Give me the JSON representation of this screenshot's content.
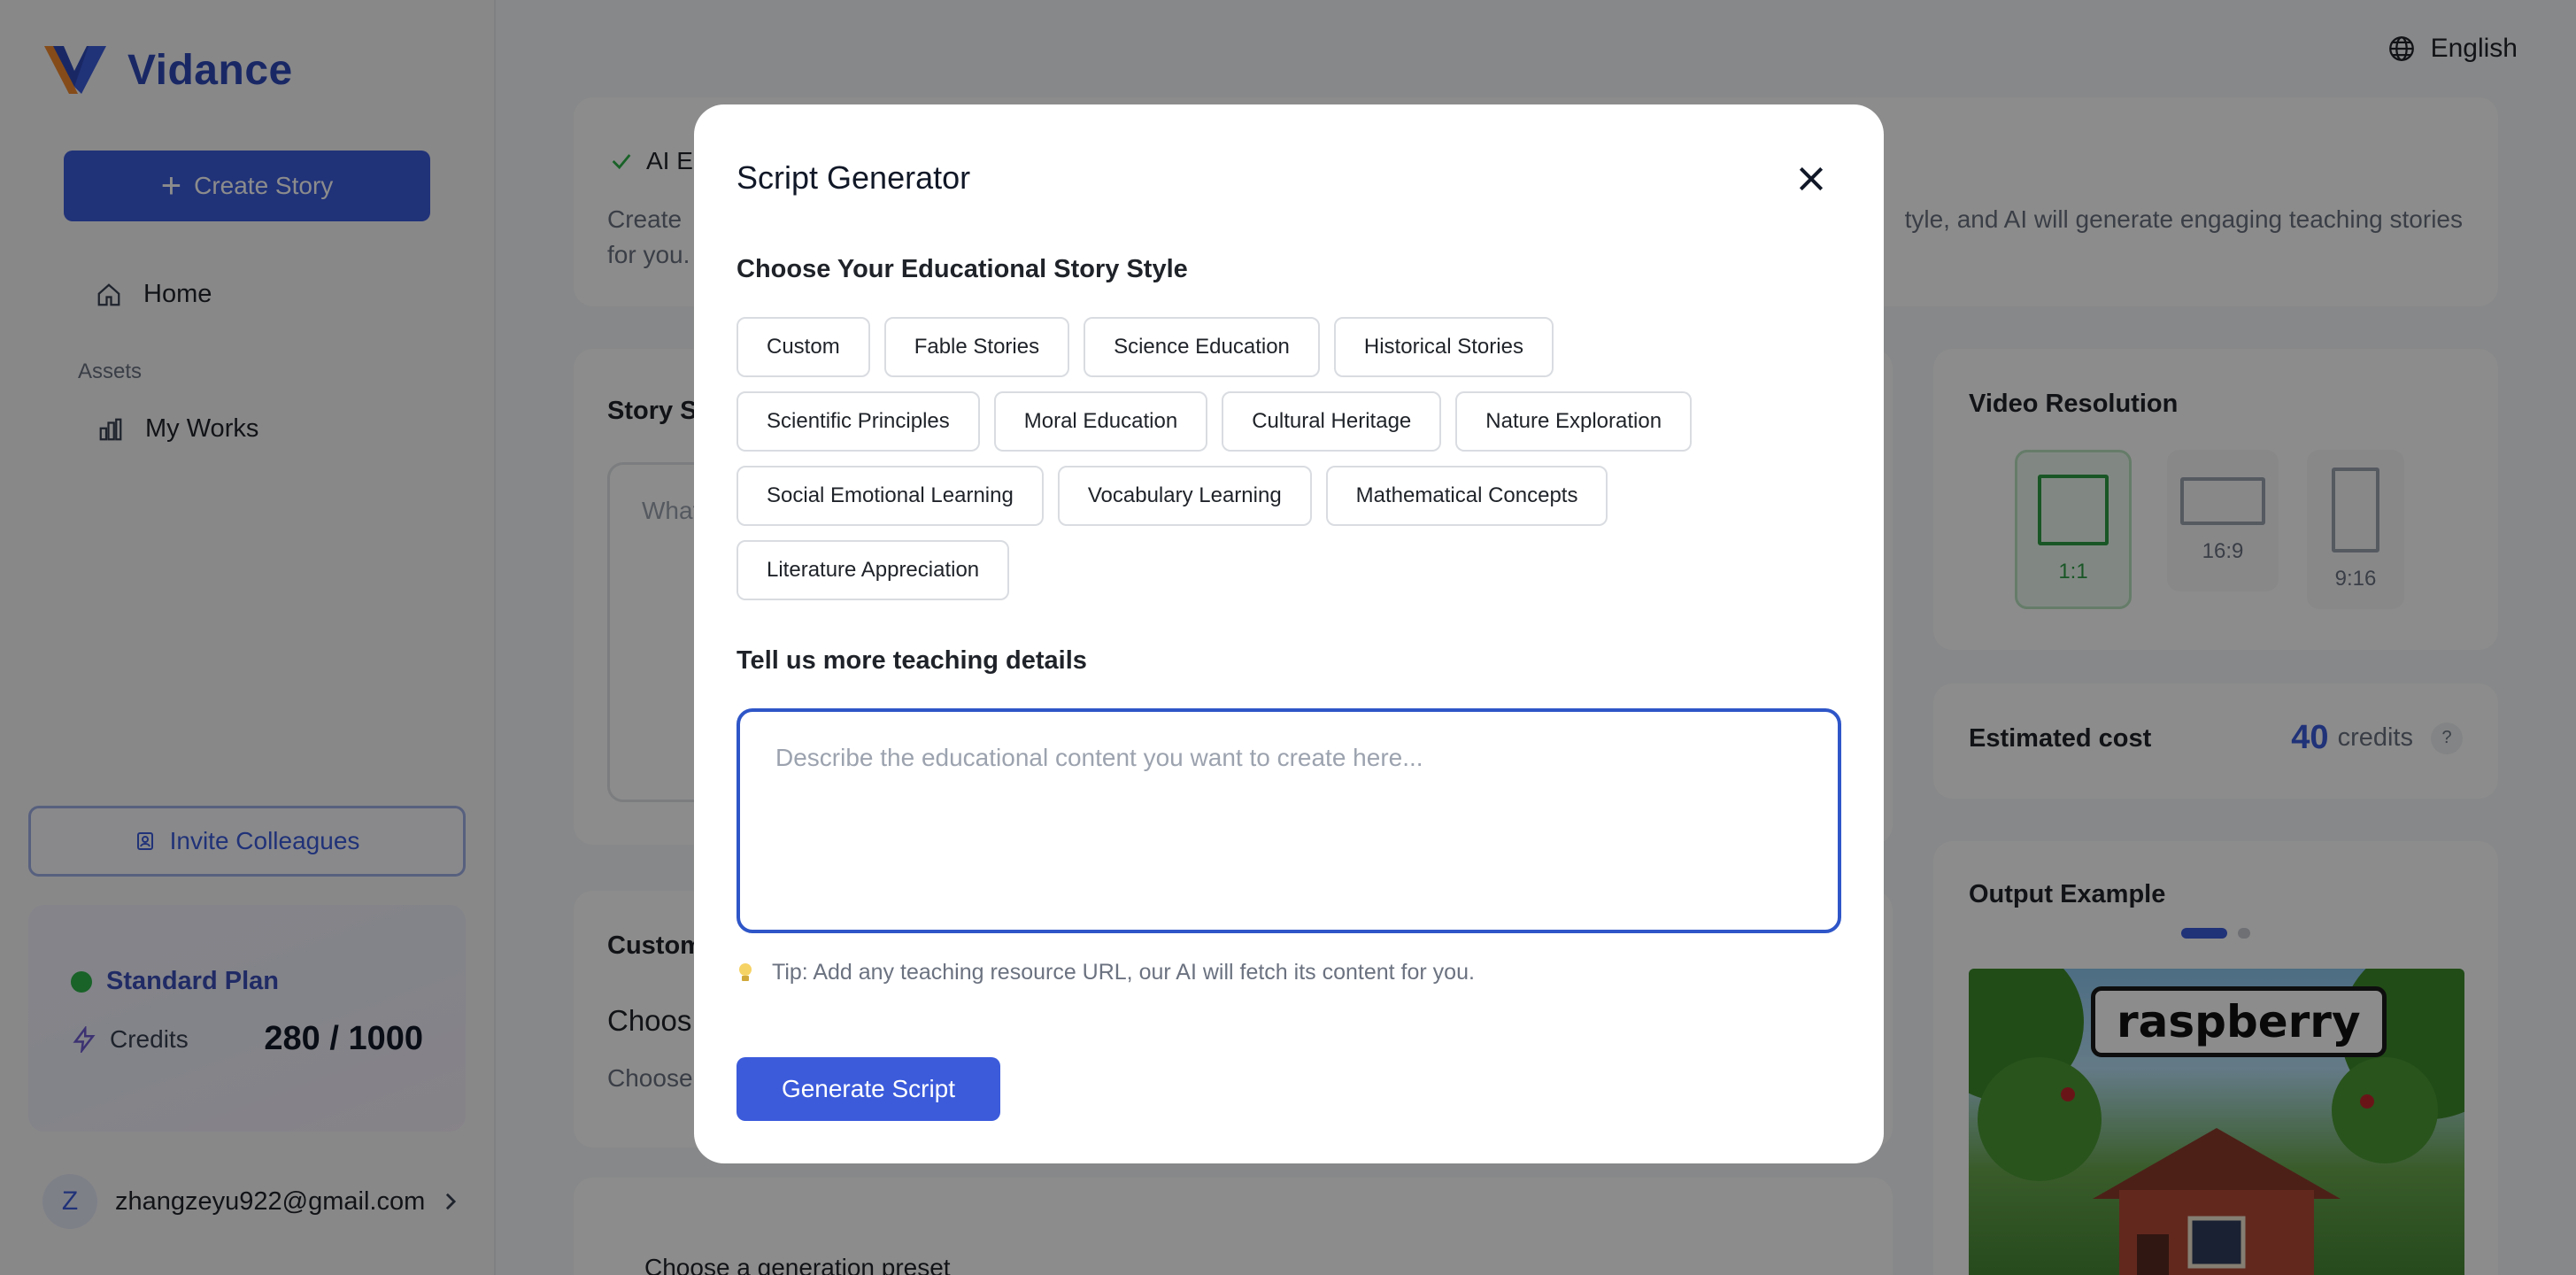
{
  "sidebar": {
    "brand_name": "Vidance",
    "create_label": "Create Story",
    "home_label": "Home",
    "assets_label": "Assets",
    "works_label": "My Works",
    "invite_label": "Invite Colleagues",
    "plan_name": "Standard Plan",
    "credits_label": "Credits",
    "credits_value": "280 / 1000",
    "avatar_initial": "Z",
    "user_email": "zhangzeyu922@gmail.com"
  },
  "header": {
    "language": "English"
  },
  "main": {
    "info_heading": "AI E",
    "info_text_left": "Create",
    "info_text_right": "tyle, and AI will generate engaging teaching stories",
    "info_text_line2": "for you.",
    "story_title": "Story S",
    "story_placeholder": "What",
    "custom_title": "Custom",
    "choose_title": "Choos",
    "choose_sub": "Choose",
    "preset_text": "Choose a generation preset",
    "resolution_title": "Video Resolution",
    "resolutions": [
      "1:1",
      "16:9",
      "9:16"
    ],
    "cost_label": "Estimated cost",
    "cost_value": "40",
    "cost_unit": "credits",
    "cost_help": "?",
    "output_title": "Output Example",
    "example_word": "raspberry"
  },
  "modal": {
    "title": "Script Generator",
    "style_label": "Choose Your Educational Story Style",
    "styles": [
      [
        "Custom",
        "Fable Stories",
        "Science Education",
        "Historical Stories"
      ],
      [
        "Scientific Principles",
        "Moral Education",
        "Cultural Heritage",
        "Nature Exploration"
      ],
      [
        "Social Emotional Learning",
        "Vocabulary Learning",
        "Mathematical Concepts"
      ],
      [
        "Literature Appreciation"
      ]
    ],
    "details_label": "Tell us more teaching details",
    "details_placeholder": "Describe the educational content you want to create here...",
    "details_value": "",
    "tip": "Tip: Add any teaching resource URL, our AI will fetch its content for you.",
    "generate_label": "Generate Script"
  },
  "colors": {
    "accent": "#3b5bdb",
    "plan_dot": "#2fb34a",
    "selected_resolution": "#2f9d45"
  },
  "icons": [
    "logo-icon",
    "plus-icon",
    "home-icon",
    "chart-icon",
    "invite-icon",
    "lightning-icon",
    "chevron-right-icon",
    "globe-icon",
    "check-icon",
    "close-icon",
    "lightbulb-icon"
  ]
}
